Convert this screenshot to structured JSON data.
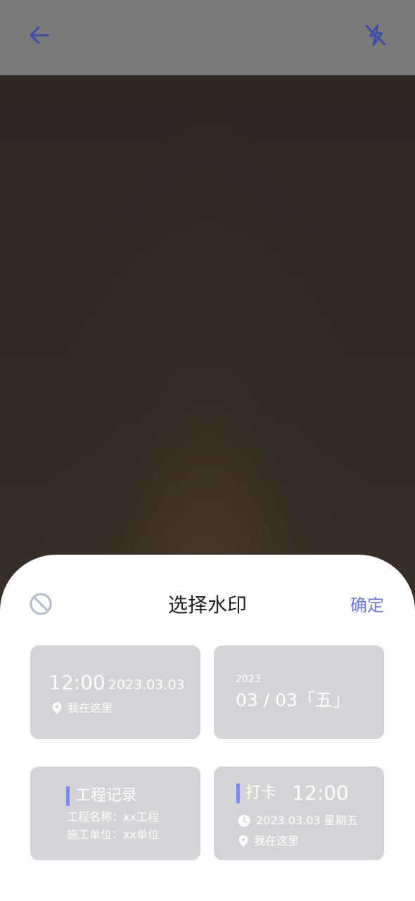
{
  "colors": {
    "accent": "#6b78d4",
    "card_bg": "#d3d3d8",
    "accent_bar": "#7b8af0",
    "top_bar": "#7a7a7a"
  },
  "top_bar": {
    "back_icon": "arrow-left-icon",
    "flash_icon": "flash-off-icon"
  },
  "sheet": {
    "none_icon": "no-watermark-icon",
    "title": "选择水印",
    "confirm_label": "确定"
  },
  "watermarks": [
    {
      "time": "12:00",
      "date": "2023.03.03",
      "location": "我在这里"
    },
    {
      "year": "2023",
      "date": "03 / 03「五」"
    },
    {
      "title": "工程记录",
      "lines": [
        "工程名称：xx工程",
        "施工单位：xx单位"
      ]
    },
    {
      "label": "打卡",
      "time": "12:00",
      "datetime": "2023.03.03 星期五",
      "location": "我在这里"
    }
  ]
}
